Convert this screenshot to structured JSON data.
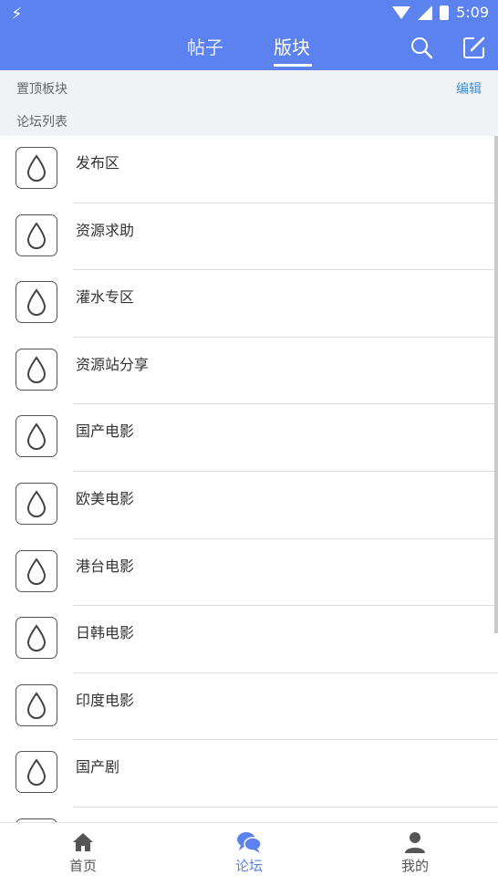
{
  "status": {
    "time": "5:09"
  },
  "header": {
    "tabs": [
      {
        "label": "帖子",
        "active": false
      },
      {
        "label": "版块",
        "active": true
      }
    ],
    "icons": [
      "search-icon",
      "edit-icon"
    ]
  },
  "pinned": {
    "label": "置顶板块",
    "edit_label": "编辑"
  },
  "forum_list": {
    "label": "论坛列表",
    "items": [
      {
        "title": "发布区"
      },
      {
        "title": "资源求助"
      },
      {
        "title": "灌水专区"
      },
      {
        "title": "资源站分享"
      },
      {
        "title": "国产电影"
      },
      {
        "title": "欧美电影"
      },
      {
        "title": "港台电影"
      },
      {
        "title": "日韩电影"
      },
      {
        "title": "印度电影"
      },
      {
        "title": "国产剧"
      },
      {
        "title": ""
      }
    ]
  },
  "bottom_nav": {
    "items": [
      {
        "label": "首页",
        "icon": "home-icon",
        "active": false
      },
      {
        "label": "论坛",
        "icon": "chat-icon",
        "active": true
      },
      {
        "label": "我的",
        "icon": "user-icon",
        "active": false
      }
    ]
  },
  "colors": {
    "primary": "#5b82ee",
    "link": "#3b8fd9",
    "section_bg": "#f1f2f5"
  }
}
